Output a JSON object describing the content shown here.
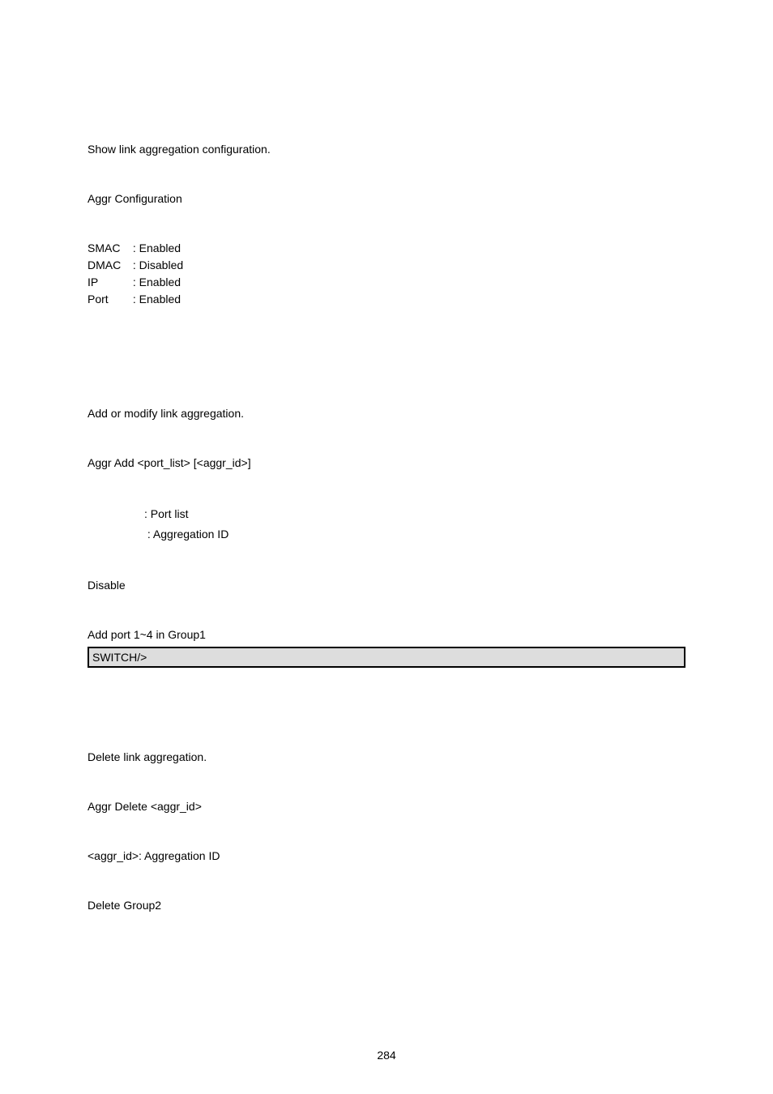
{
  "section1": {
    "desc": "Show link aggregation configuration.",
    "config_title": "Aggr Configuration",
    "rows": {
      "smac_label": "SMAC",
      "smac_value": ": Enabled",
      "dmac_label": "DMAC",
      "dmac_value": ": Disabled",
      "ip_label": "IP",
      "ip_value": ": Enabled",
      "port_label": "Port",
      "port_value": ": Enabled"
    }
  },
  "section2": {
    "desc": "Add or modify link aggregation.",
    "syntax": "Aggr Add <port_list> [<aggr_id>]",
    "param_portlist": "                  : Port list",
    "param_aggrid": "                   : Aggregation ID",
    "default_setting": "Disable",
    "example_desc": "Add port 1~4 in Group1",
    "example_code": "SWITCH/>"
  },
  "section3": {
    "desc": "Delete link aggregation.",
    "syntax": "Aggr Delete <aggr_id>",
    "param_aggrid": "<aggr_id>: Aggregation ID",
    "example_desc": "Delete Group2"
  },
  "page_number": "284"
}
